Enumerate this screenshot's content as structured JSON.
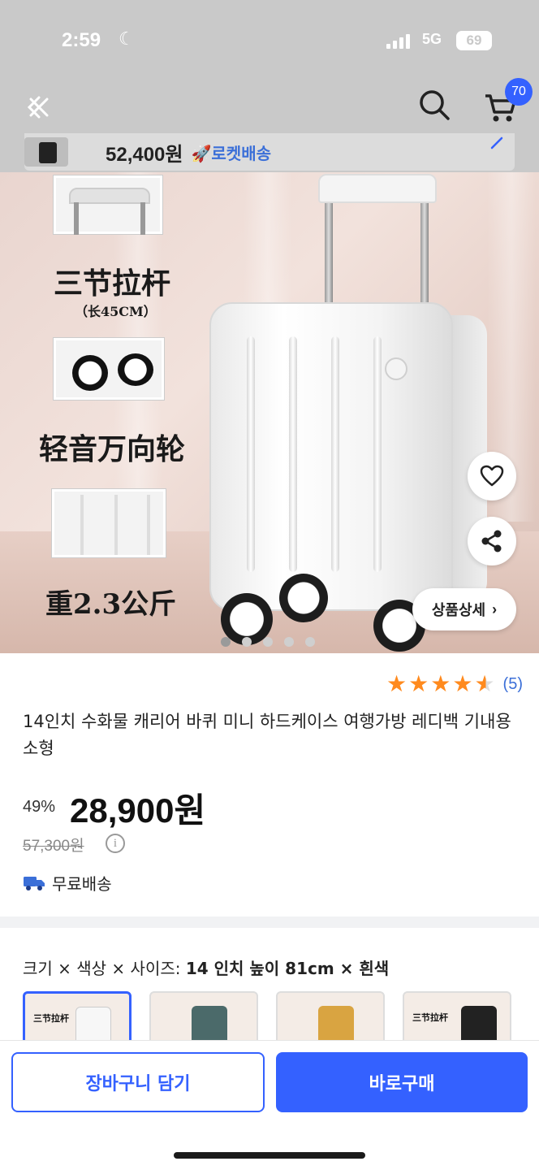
{
  "status_bar": {
    "time": "2:59",
    "network": "5G",
    "battery": "69"
  },
  "header": {
    "cart_count": "70"
  },
  "sticky": {
    "price": "52,400원",
    "delivery": "로켓배송"
  },
  "hero": {
    "feature_handle": "三节拉杆",
    "feature_handle_sub": "（长45CM）",
    "feature_wheels": "轻音万向轮",
    "feature_weight": "重2.3公斤",
    "detail_button": "상품상세",
    "dots_total": 5,
    "dots_active": 0
  },
  "product": {
    "rating": 4.5,
    "review_count": "(5)",
    "title": "14인치 수화물 캐리어 바퀴 미니 하드케이스 여행가방 레디백 기내용 소형",
    "discount": "49%",
    "price": "28,900원",
    "original_price": "57,300원",
    "shipping": "무료배송"
  },
  "options": {
    "label_prefix": "크기 × 색상 × 사이즈:",
    "label_selected": "14 인치 높이 81cm × 흰색",
    "thumb_text": "三节拉杆"
  },
  "actions": {
    "cart_label": "장바구니 담기",
    "buy_label": "바로구매"
  },
  "colors": {
    "accent": "#3461ff",
    "star": "#ff8a1e",
    "rocket": "#3b6fd8"
  }
}
